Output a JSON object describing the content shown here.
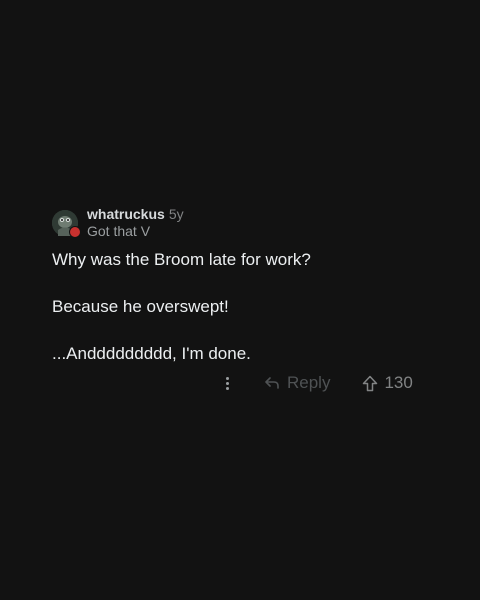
{
  "comment": {
    "username": "whatruckus",
    "age": "5y",
    "flair": "Got that V",
    "avatar_icon": "user-avatar-icon",
    "body": [
      "Why was the Broom late for work?",
      "Because he overswept!",
      "...Anddddddddd, I'm done."
    ]
  },
  "actions": {
    "more_icon": "more-options-icon",
    "reply_icon": "reply-arrow-icon",
    "reply_label": "Reply",
    "upvote_icon": "upvote-arrow-icon",
    "score": "130"
  }
}
